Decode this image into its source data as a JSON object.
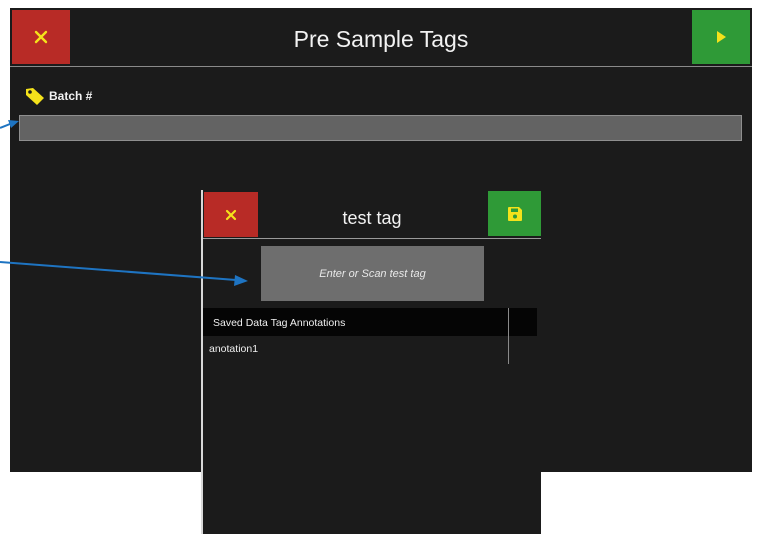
{
  "header": {
    "title": "Pre Sample Tags",
    "close_icon": "close-icon",
    "next_icon": "play-icon"
  },
  "batch": {
    "label": "Batch #",
    "icon": "tag-icon",
    "value": ""
  },
  "dialog": {
    "title": "test tag",
    "close_icon": "close-icon",
    "save_icon": "save-icon",
    "tag_button_label": "Enter or Scan test tag",
    "list_header": "Saved Data Tag Annotations",
    "items": [
      "anotation1"
    ]
  },
  "colors": {
    "background": "#1b1b1b",
    "close_red": "#b82b26",
    "action_green": "#2f9a37",
    "icon_yellow": "#f4e21b",
    "annotation_arrow": "#1e74c2"
  }
}
